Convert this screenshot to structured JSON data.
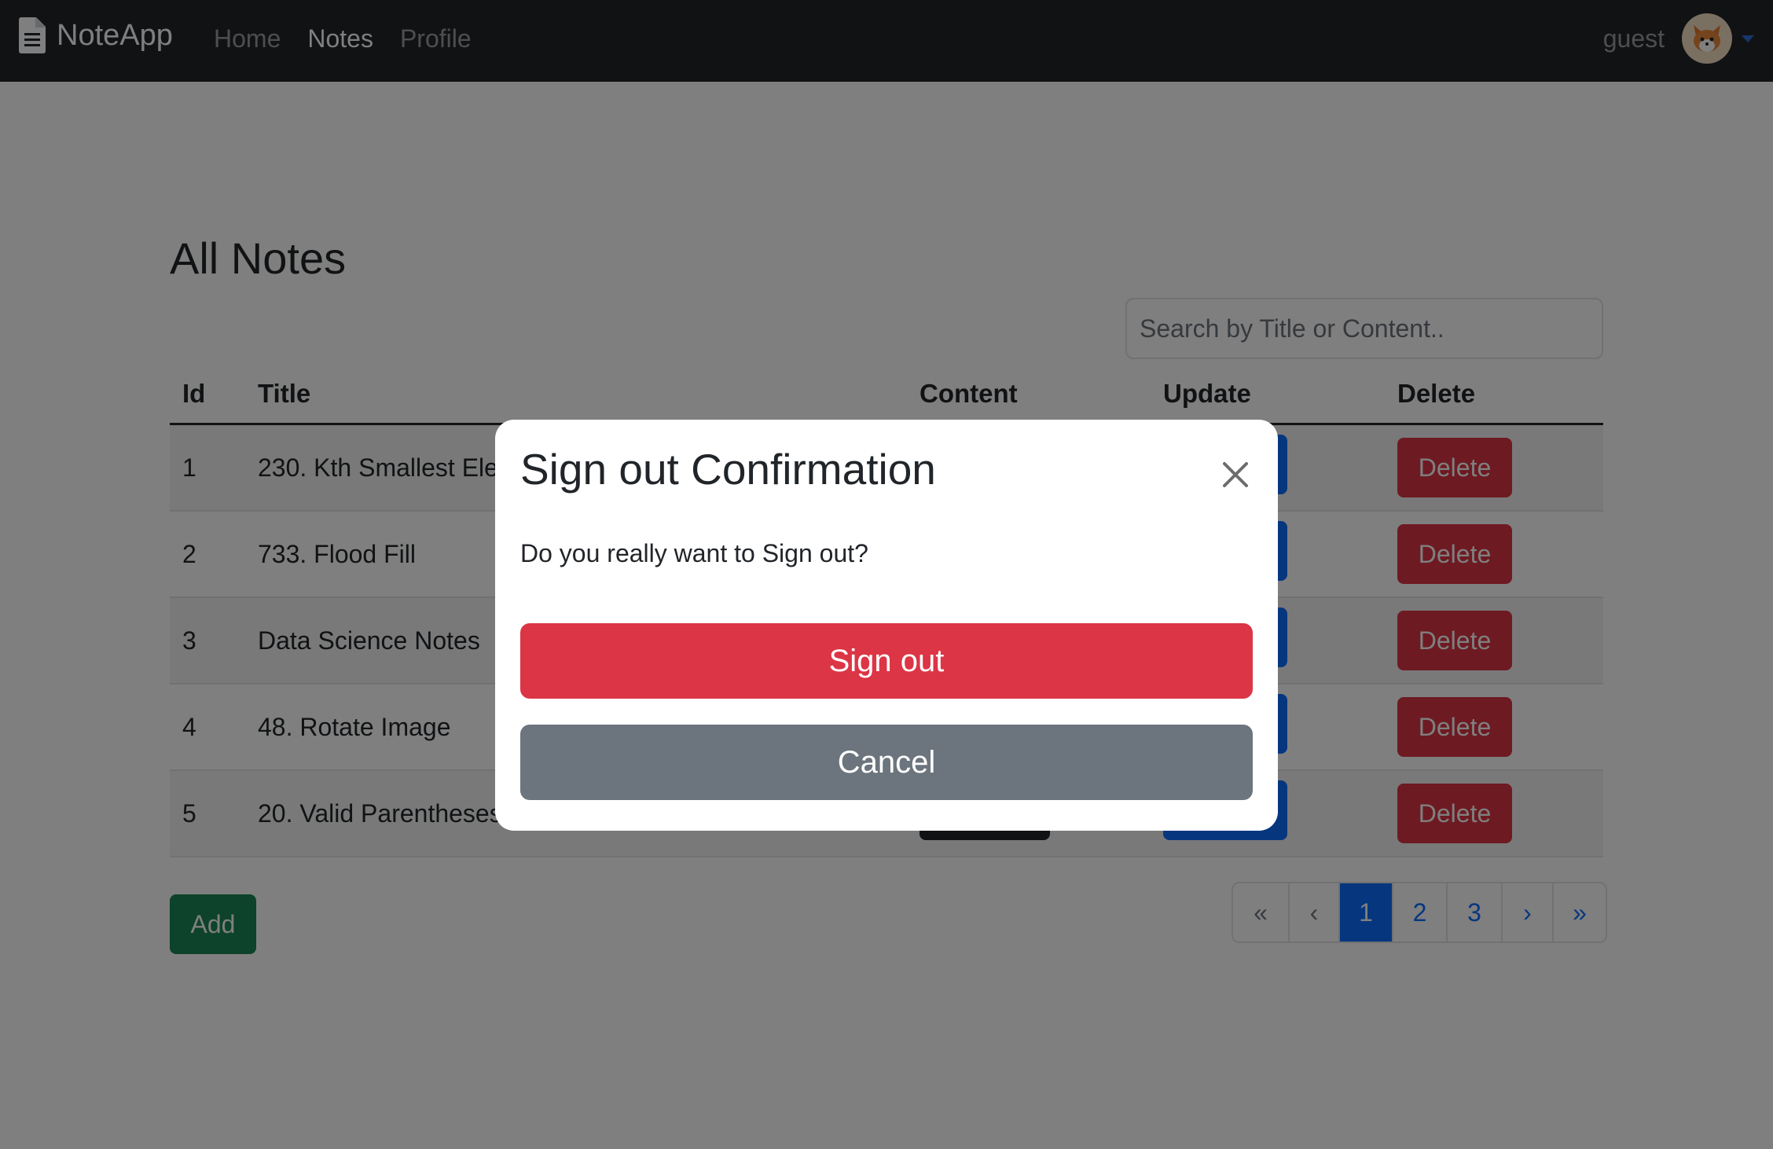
{
  "navbar": {
    "brand": "NoteApp",
    "links": [
      {
        "label": "Home",
        "active": false
      },
      {
        "label": "Notes",
        "active": true
      },
      {
        "label": "Profile",
        "active": false
      }
    ],
    "user": "guest"
  },
  "main": {
    "title": "All Notes",
    "search_placeholder": "Search by Title or Content..",
    "columns": [
      "Id",
      "Title",
      "Content",
      "Update",
      "Delete"
    ],
    "rows": [
      {
        "id": "1",
        "title": "230. Kth Smallest Ele",
        "view": "",
        "update": "",
        "delete": "Delete"
      },
      {
        "id": "2",
        "title": "733. Flood Fill",
        "view": "",
        "update": "",
        "delete": "Delete"
      },
      {
        "id": "3",
        "title": "Data Science Notes",
        "view": "",
        "update": "",
        "delete": "Delete"
      },
      {
        "id": "4",
        "title": "48. Rotate Image",
        "view": "",
        "update": "",
        "delete": "Delete"
      },
      {
        "id": "5",
        "title": "20. Valid Parentheses",
        "view": "",
        "update": "",
        "delete": "Delete"
      }
    ],
    "add_label": "Add",
    "pagination": [
      "«",
      "‹",
      "1",
      "2",
      "3",
      "›",
      "»"
    ],
    "current_page": "1"
  },
  "modal": {
    "title": "Sign out Confirmation",
    "body": "Do you really want to Sign out?",
    "confirm_label": "Sign out",
    "cancel_label": "Cancel"
  },
  "colors": {
    "navbar": "#212529",
    "primary": "#0d6efd",
    "danger": "#dc3545",
    "success": "#198754",
    "secondary": "#6c757d"
  }
}
